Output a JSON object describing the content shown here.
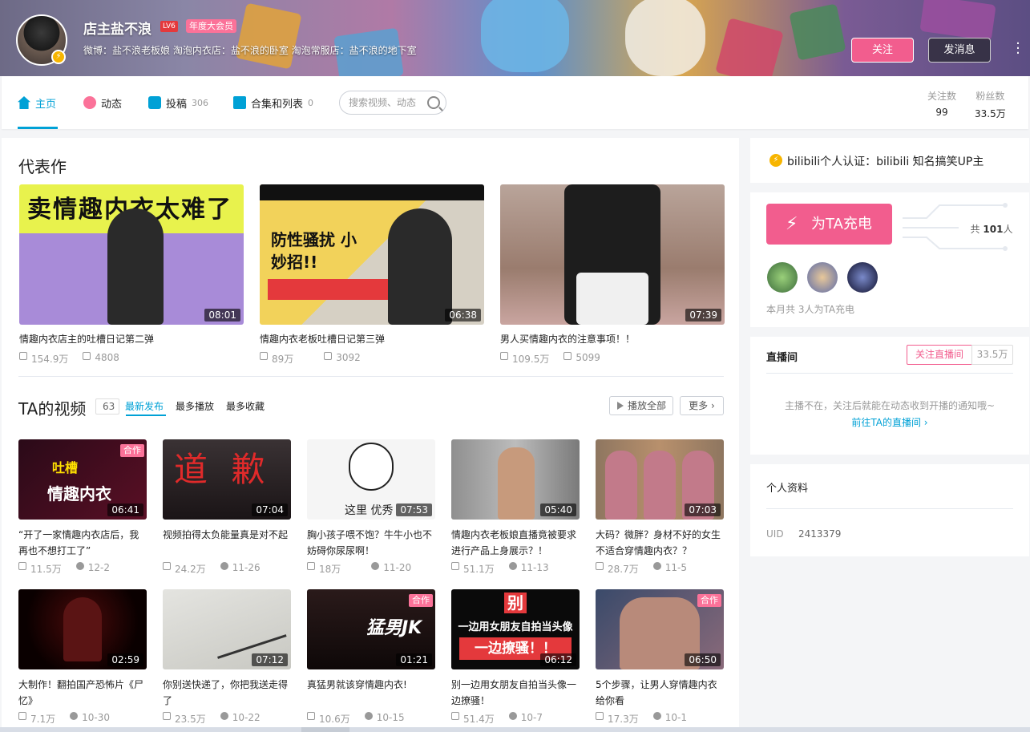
{
  "user": {
    "name": "店主盐不浪",
    "level": "LV6",
    "vip_label": "年度大会员",
    "sign": "微博：盐不浪老板娘 淘泡内衣店：盐不浪的卧室 淘泡常服店：盐不浪的地下室"
  },
  "header_buttons": {
    "follow": "关注",
    "message": "发消息"
  },
  "nav": {
    "home": "主页",
    "dynamic": "动态",
    "posts": "投稿",
    "posts_count": "306",
    "collections": "合集和列表",
    "collections_count": "0",
    "search_placeholder": "搜索视频、动态"
  },
  "stats": {
    "following_label": "关注数",
    "following": "99",
    "fans_label": "粉丝数",
    "fans": "33.5万"
  },
  "representative": {
    "title": "代表作",
    "items": [
      {
        "title": "情趣内衣店主的吐槽日记第二弹",
        "duration": "08:01",
        "plays": "154.9万",
        "danmaku": "4808",
        "cover_text": "卖情趣内衣太难了"
      },
      {
        "title": "情趣内衣老板吐槽日记第三弹",
        "duration": "06:38",
        "plays": "89万",
        "danmaku": "3092",
        "cover_text": "防性骚扰 小妙招!!"
      },
      {
        "title": "男人买情趣内衣的注意事项！！",
        "duration": "07:39",
        "plays": "109.5万",
        "danmaku": "5099",
        "cover_text": ""
      }
    ]
  },
  "videos": {
    "title": "TA的视频",
    "count": "63",
    "tabs": [
      "最新发布",
      "最多播放",
      "最多收藏"
    ],
    "play_all": "播放全部",
    "more": "更多",
    "items": [
      {
        "title": "“开了一家情趣内衣店后，我再也不想打工了”",
        "duration": "06:41",
        "plays": "11.5万",
        "date": "12-2",
        "badge": "合作",
        "cover_text": "情趣内衣"
      },
      {
        "title": "视频拍得太负能量真是对不起",
        "duration": "07:04",
        "plays": "24.2万",
        "date": "11-26",
        "badge": "",
        "cover_text": "道 歉"
      },
      {
        "title": "胸小孩子喂不饱？牛牛小也不妨碍你尿尿啊！",
        "duration": "07:53",
        "plays": "18万",
        "date": "11-20",
        "badge": "",
        "cover_text": "这里 优秀"
      },
      {
        "title": "情趣内衣老板娘直播竟被要求进行产品上身展示？！",
        "duration": "05:40",
        "plays": "51.1万",
        "date": "11-13",
        "badge": "",
        "cover_text": ""
      },
      {
        "title": "大码？微胖？身材不好的女生不适合穿情趣内衣？？",
        "duration": "07:03",
        "plays": "28.7万",
        "date": "11-5",
        "badge": "",
        "cover_text": ""
      },
      {
        "title": "大制作！翻拍国产恐怖片《尸忆》",
        "duration": "02:59",
        "plays": "7.1万",
        "date": "10-30",
        "badge": "",
        "cover_text": ""
      },
      {
        "title": "你别送快递了，你把我送走得了",
        "duration": "07:12",
        "plays": "23.5万",
        "date": "10-22",
        "badge": "",
        "cover_text": ""
      },
      {
        "title": "真猛男就该穿情趣内衣!",
        "duration": "01:21",
        "plays": "10.6万",
        "date": "10-15",
        "badge": "合作",
        "cover_text": "猛男JK"
      },
      {
        "title": "别一边用女朋友自拍当头像一边撩骚！",
        "duration": "06:12",
        "plays": "51.4万",
        "date": "10-7",
        "badge": "",
        "cover_text": "一边撩骚！！"
      },
      {
        "title": "5个步骤，让男人穿情趣内衣给你看",
        "duration": "06:50",
        "plays": "17.3万",
        "date": "10-1",
        "badge": "合作",
        "cover_text": ""
      }
    ]
  },
  "side": {
    "cert": "bilibili个人认证：bilibili 知名搞笑UP主",
    "charge_button": "为TA充电",
    "charge_total_prefix": "共",
    "charge_total": "101",
    "charge_total_suffix": "人",
    "charge_month": "本月共 3人为TA充电",
    "live_title": "直播间",
    "live_follow": "关注直播间",
    "live_fans": "33.5万",
    "live_offline": "主播不在，关注后就能在动态收到开播的通知哦~",
    "live_goto": "前往TA的直播间",
    "profile_title": "个人资料",
    "uid_label": "UID",
    "uid": "2413379"
  },
  "colors": {
    "accent": "#00a1d6",
    "pink": "#fb7299",
    "follow_btn": "#f25d8e"
  }
}
